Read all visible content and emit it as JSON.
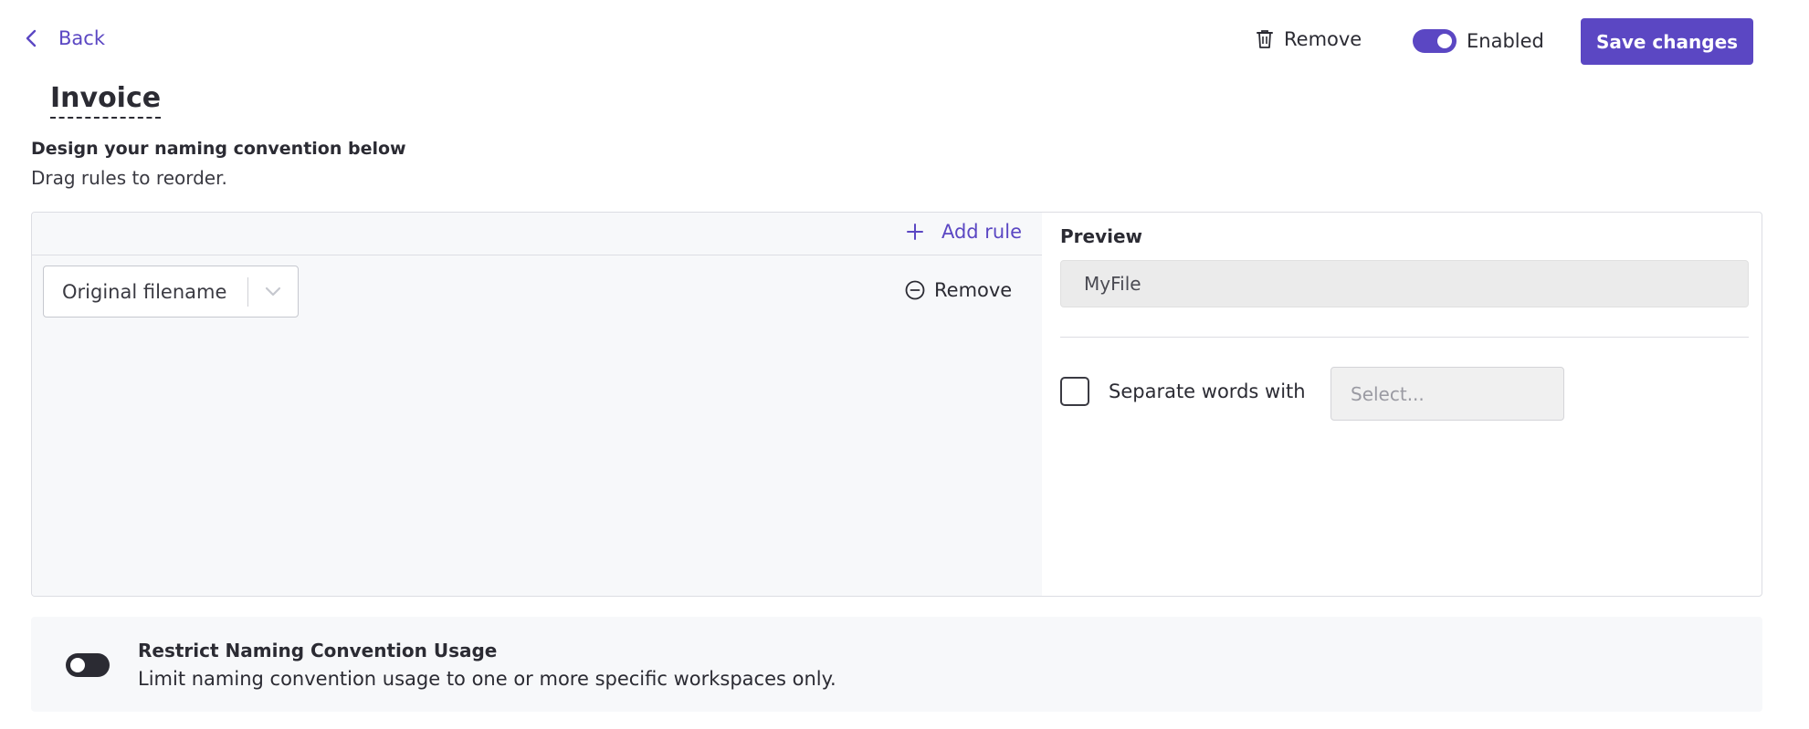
{
  "header": {
    "back_label": "Back",
    "remove_label": "Remove",
    "enabled_label": "Enabled",
    "enabled": true,
    "save_label": "Save changes"
  },
  "page": {
    "title": "Invoice",
    "subtitle": "Design your naming convention below",
    "hint": "Drag rules to reorder."
  },
  "rules": {
    "add_rule_label": "Add rule",
    "items": [
      {
        "value": "Original filename",
        "remove_label": "Remove"
      }
    ]
  },
  "preview": {
    "label": "Preview",
    "value": "MyFile",
    "separate_label": "Separate words with",
    "separate_checked": false,
    "separator_placeholder": "Select..."
  },
  "restrict": {
    "title": "Restrict Naming Convention Usage",
    "description": "Limit naming convention usage to one or more specific workspaces only.",
    "enabled": false
  },
  "colors": {
    "accent": "#5b47c3",
    "text": "#2b2b33",
    "panel_bg": "#f7f8fa"
  },
  "icons": {
    "back": "chevron-left-icon",
    "remove": "trash-icon",
    "add": "plus-icon",
    "rule_remove": "minus-circle-icon",
    "select": "chevron-down-icon"
  }
}
